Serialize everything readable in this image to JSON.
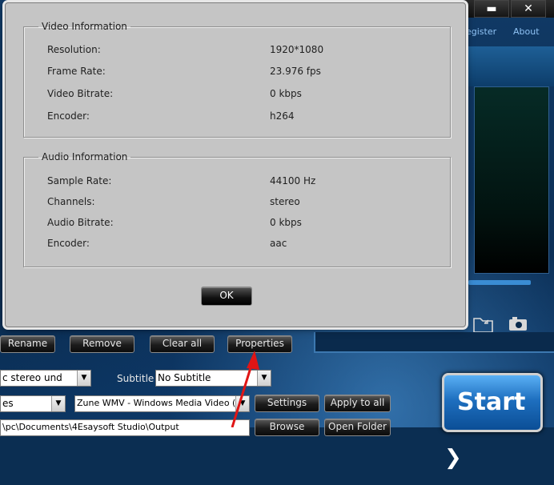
{
  "window": {
    "minimize_glyph": "▬",
    "close_glyph": "✕"
  },
  "top_links": {
    "register": "egister",
    "about": "About"
  },
  "dialog": {
    "video": {
      "title": "Video Information",
      "rows": [
        {
          "label": "Resolution:",
          "value": "1920*1080"
        },
        {
          "label": "Frame Rate:",
          "value": "23.976 fps"
        },
        {
          "label": "Video Bitrate:",
          "value": "0 kbps"
        },
        {
          "label": "Encoder:",
          "value": "h264"
        }
      ]
    },
    "audio": {
      "title": "Audio Information",
      "rows": [
        {
          "label": "Sample Rate:",
          "value": "44100 Hz"
        },
        {
          "label": "Channels:",
          "value": "stereo"
        },
        {
          "label": "Audio Bitrate:",
          "value": "0 kbps"
        },
        {
          "label": "Encoder:",
          "value": "aac"
        }
      ]
    },
    "ok_label": "OK"
  },
  "toolbar": {
    "rename": "Rename",
    "remove": "Remove",
    "clear_all": "Clear all",
    "properties": "Properties"
  },
  "settings_panel": {
    "audio_track_value": "c stereo und",
    "subtitle_label": "Subtitle",
    "subtitle_value": "No Subtitle",
    "profile_category_value": "es",
    "profile_value": "Zune WMV - Windows Media Video (*.w...",
    "settings_label": "Settings",
    "apply_all_label": "Apply to all",
    "destination_value": "\\pc\\Documents\\4Esaysoft Studio\\Output",
    "browse_label": "Browse",
    "open_folder_label": "Open Folder"
  },
  "start_label": "Start"
}
